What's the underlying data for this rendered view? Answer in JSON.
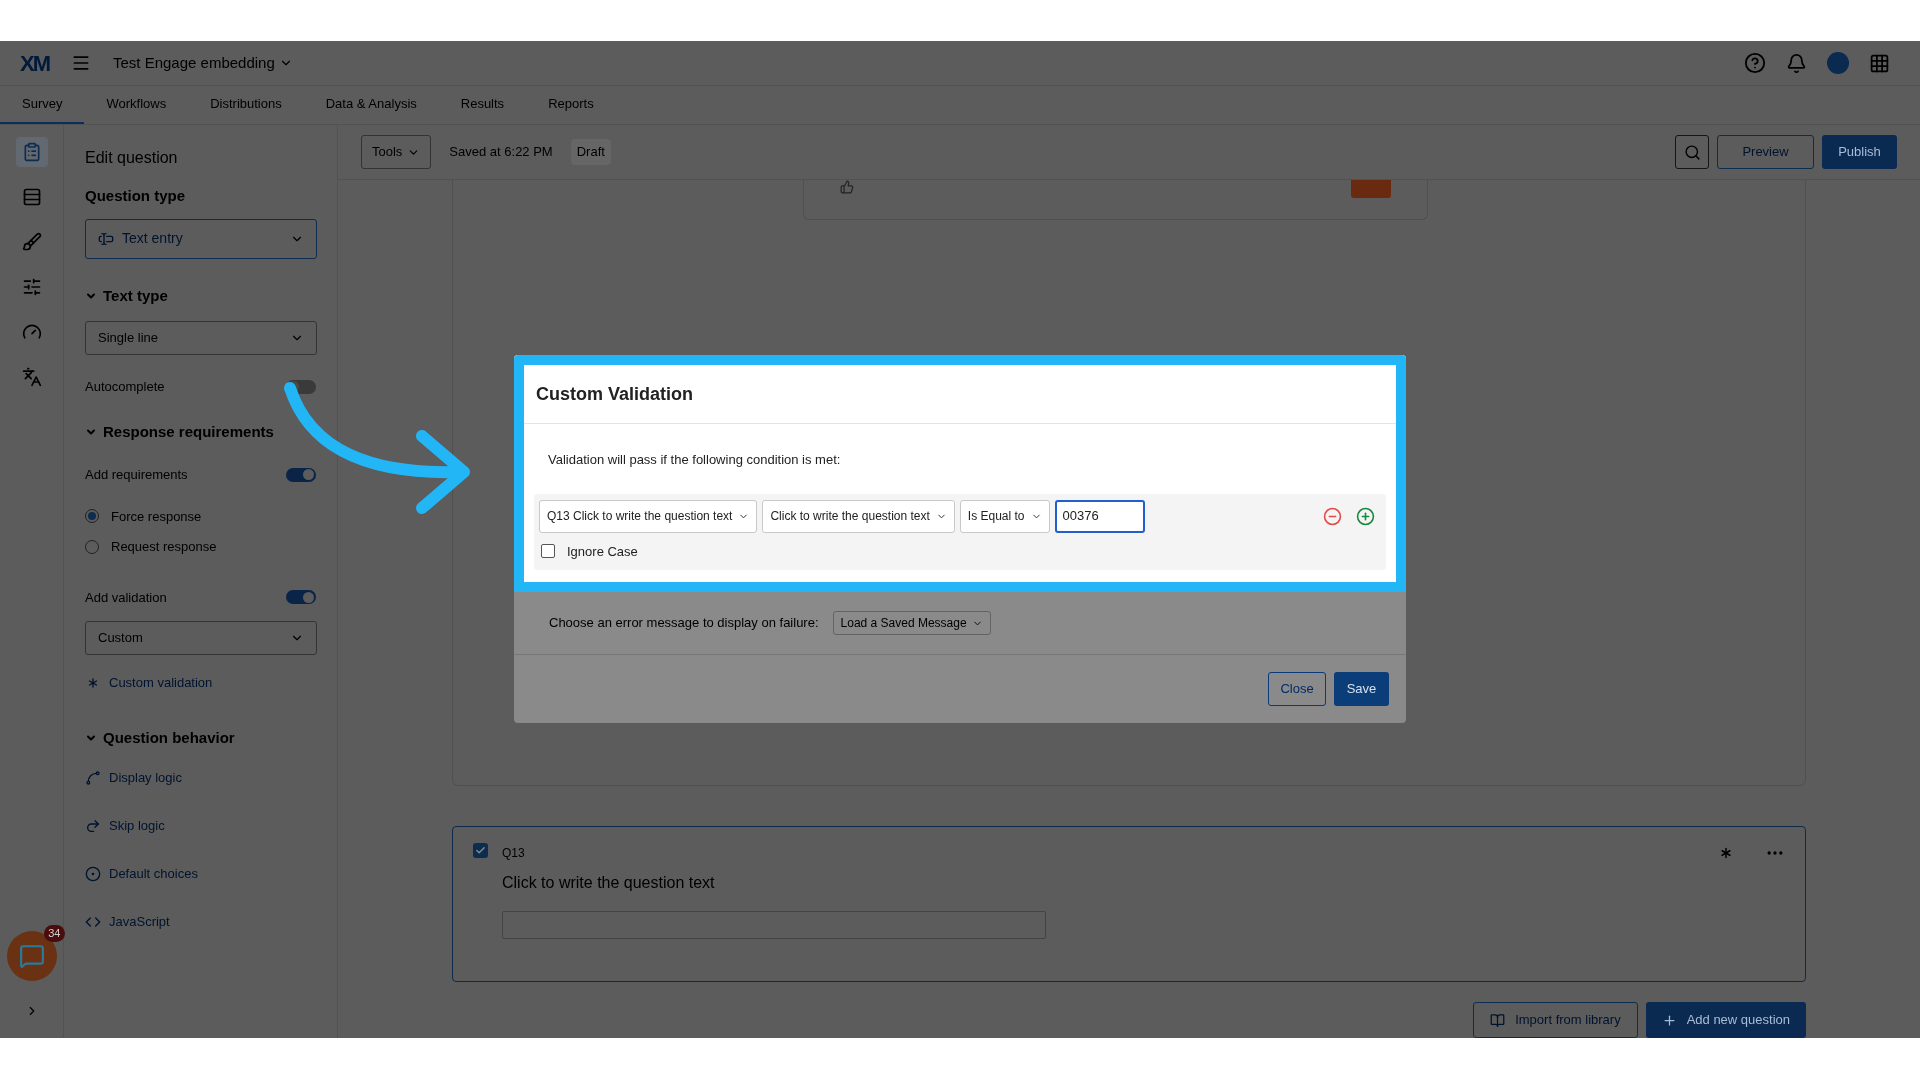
{
  "header": {
    "logo": "XM",
    "project_title": "Test Engage embedding"
  },
  "tabs": [
    {
      "label": "Survey",
      "selected": true
    },
    {
      "label": "Workflows",
      "selected": false
    },
    {
      "label": "Distributions",
      "selected": false
    },
    {
      "label": "Data & Analysis",
      "selected": false
    },
    {
      "label": "Results",
      "selected": false
    },
    {
      "label": "Reports",
      "selected": false
    }
  ],
  "toolbar": {
    "tools": "Tools",
    "saved": "Saved at 6:22 PM",
    "status": "Draft",
    "preview": "Preview",
    "publish": "Publish"
  },
  "edit_panel": {
    "title": "Edit question",
    "question_type": {
      "label": "Question type",
      "value": "Text entry"
    },
    "text_type": {
      "heading": "Text type",
      "expanded": true,
      "value": "Single line"
    },
    "autocomplete": {
      "label": "Autocomplete",
      "on": false
    },
    "response_requirements": {
      "heading": "Response requirements",
      "expanded": true,
      "add_requirements": {
        "label": "Add requirements",
        "on": true
      },
      "radios": [
        {
          "label": "Force response",
          "selected": true
        },
        {
          "label": "Request response",
          "selected": false
        }
      ],
      "add_validation": {
        "label": "Add validation",
        "on": true
      },
      "validation_type": "Custom",
      "custom_validation": "Custom validation"
    },
    "question_behavior": {
      "heading": "Question behavior",
      "expanded": true,
      "links": [
        "Display logic",
        "Skip logic",
        "Default choices",
        "JavaScript"
      ]
    }
  },
  "chat": {
    "badge": "34"
  },
  "modal": {
    "title": "Custom Validation",
    "instruction": "Validation will pass if the following condition is met:",
    "condition": {
      "question": "Q13 Click to write the question text",
      "field": "Click to write the question text",
      "operator": "Is Equal to",
      "value": "00376"
    },
    "ignore_case": {
      "label": "Ignore Case",
      "checked": false
    },
    "error_label": "Choose an error message to display on failure:",
    "error_select": "Load a Saved Message",
    "buttons": {
      "close": "Close",
      "save": "Save"
    }
  },
  "question_card": {
    "checked": true,
    "number": "Q13",
    "text": "Click to write the question text"
  },
  "footer": {
    "import": "Import from library",
    "add": "Add new question"
  }
}
